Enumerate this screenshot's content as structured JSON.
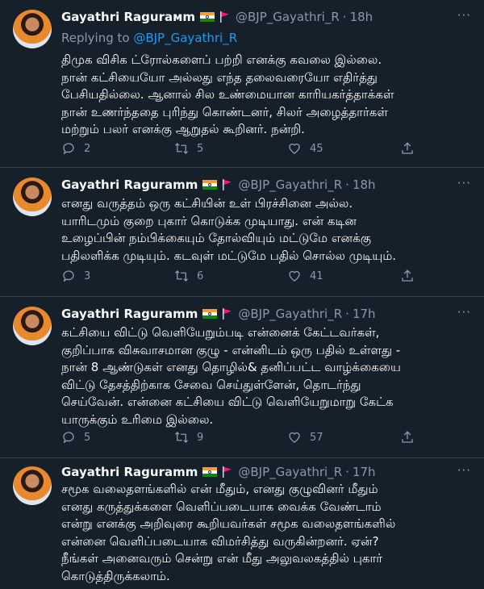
{
  "tweets": [
    {
      "name": "Gayathri Ragurамm",
      "handle": "@BJP_Gayathri_R",
      "dot": "·",
      "time": "18h",
      "replying_prefix": "Replying to ",
      "replying_handle": "@BJP_Gayathri_R",
      "text": "திமுக விசிக ட்ரோல்களைப் பற்றி எனக்கு கவலை இல்லை.\nநான் கட்சியையோ அல்லது எந்த தலைவரையோ எதிர்த்து\nபேசியதில்லை. ஆனால் சில உண்மையான காரியகர்த்தாக்கள்\nநான் உணர்ந்ததை புரிந்து கொண்டனர், சிலர் அழைத்தார்கள்\nமற்றும் பலர் எனக்கு ஆறுதல் கூறினர்.  நன்றி.",
      "replies": "2",
      "retweets": "5",
      "likes": "45"
    },
    {
      "name": "Gayathri Raguramm",
      "handle": "@BJP_Gayathri_R",
      "dot": "·",
      "time": "18h",
      "text": "எனது வருத்தம் ஒரு கட்சியின் உள் பிரச்சினை அல்ல.\nயாரிடமும் குறை புகார் கொடுக்க முடியாது. என் கடின\nஉழைப்பின் நம்பிக்கையும் தோல்வியும் மட்டுமே எனக்கு\nபதிலளிக்க முடியும். கடவுள் மட்டுமே பதில் சொல்ல முடியும்.",
      "replies": "3",
      "retweets": "6",
      "likes": "41"
    },
    {
      "name": "Gayathri Raguramm",
      "handle": "@BJP_Gayathri_R",
      "dot": "·",
      "time": "17h",
      "text": "கட்சியை விட்டு வெளியேறும்படி என்னைக் கேட்டவர்கள்,\nகுறிப்பாக விசுவாசமான குழு - என்னிடம் ஒரு பதில் உள்ளது -\nநான் 8 ஆண்டுகள் எனது தொழில்& தனிப்பட்ட வாழ்க்கையை\nவிட்டு தேசத்திற்காக சேவை செய்துள்ளேன், தொடர்ந்து\nசெய்வேன். என்னை கட்சியை விட்டு வெளியேறுமாறு கேட்க\nயாருக்கும் உரிமை இல்லை.",
      "replies": "5",
      "retweets": "9",
      "likes": "57"
    },
    {
      "name": "Gayathri Raguramm",
      "handle": "@BJP_Gayathri_R",
      "dot": "·",
      "time": "17h",
      "text": "சமூக வலைதளங்களில் என் மீதும், எனது குழுவினர் மீதும்\nஎனது கருத்துக்களை வெளிப்படையாக வைக்க வேண்டாம்\nஎன்று எனக்கு அறிவுரை கூறியவர்கள் சமூக வலைதளங்களில்\nஎன்னை வெளிப்படையாக விமர்சித்து வருகின்றனர். ஏன்?\nநீங்கள் அனைவரும் சென்று என் மீது அலுவலகத்தில் புகார்\nகொடுத்திருக்கலாம்."
    }
  ],
  "more_label": "···"
}
